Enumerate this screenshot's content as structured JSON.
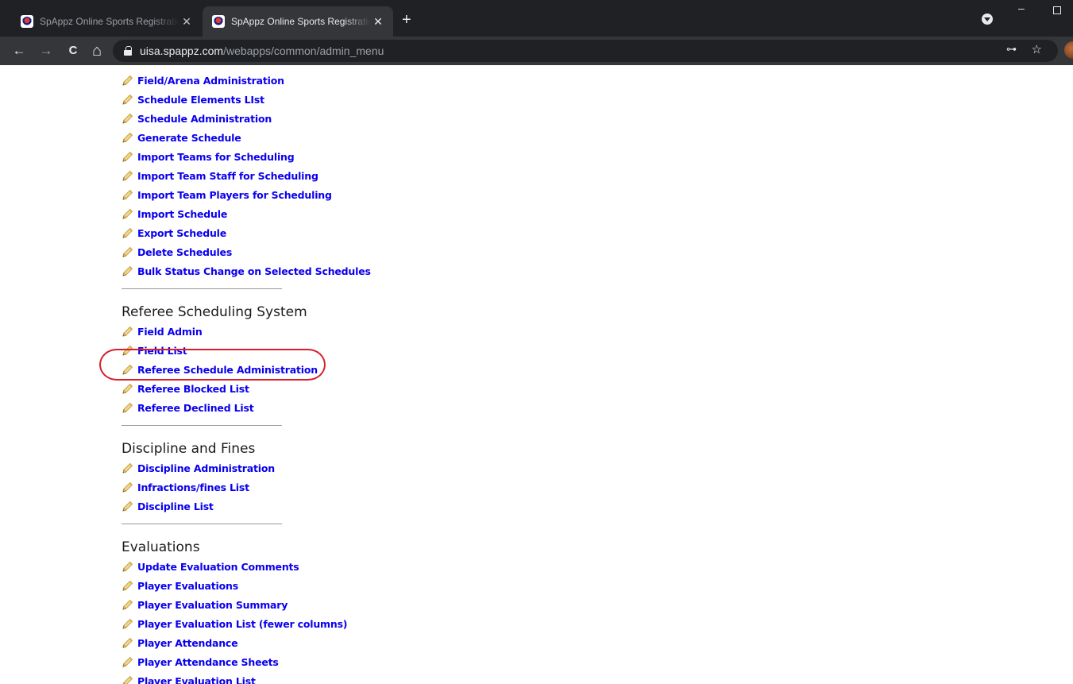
{
  "browser": {
    "tabs": [
      {
        "title": "SpAppz Online Sports Registratio",
        "close": "✕"
      },
      {
        "title": "SpAppz Online Sports Registratio",
        "close": "✕"
      }
    ],
    "new_tab": "+",
    "window_min": "–",
    "nav": {
      "back": "←",
      "forward": "→",
      "reload": "C",
      "home": "⌂"
    },
    "url_host": "uisa.spappz.com",
    "url_path": "/webapps/common/admin_menu",
    "key_icon": "key-icon",
    "star_icon": "star-icon",
    "star": "☆",
    "key": "⊶"
  },
  "page": {
    "cut_off_item": "Schedule Elements List",
    "sections": {
      "scheduling": {
        "items": [
          "Field/Arena Administration",
          "Schedule Elements LIst",
          "Schedule Administration",
          "Generate Schedule",
          "Import Teams for Scheduling",
          "Import Team Staff for Scheduling",
          "Import Team Players for Scheduling",
          "Import Schedule",
          "Export Schedule",
          "Delete Schedules",
          "Bulk Status Change on Selected Schedules"
        ]
      },
      "referee": {
        "title": "Referee Scheduling System",
        "items": [
          "Field Admin",
          "Field List",
          "Referee Schedule Administration",
          "Referee Blocked List",
          "Referee Declined List"
        ]
      },
      "discipline": {
        "title": "Discipline and Fines",
        "items": [
          "Discipline Administration",
          "Infractions/fines List",
          "Discipline List"
        ]
      },
      "evaluations": {
        "title": "Evaluations",
        "items": [
          "Update Evaluation Comments",
          "Player Evaluations",
          "Player Evaluation Summary",
          "Player Evaluation List (fewer columns)",
          "Player Attendance",
          "Player Attendance Sheets",
          "Player Evaluation List"
        ]
      }
    },
    "highlight_color": "#d61f2a",
    "link_color": "#0a00ee"
  }
}
